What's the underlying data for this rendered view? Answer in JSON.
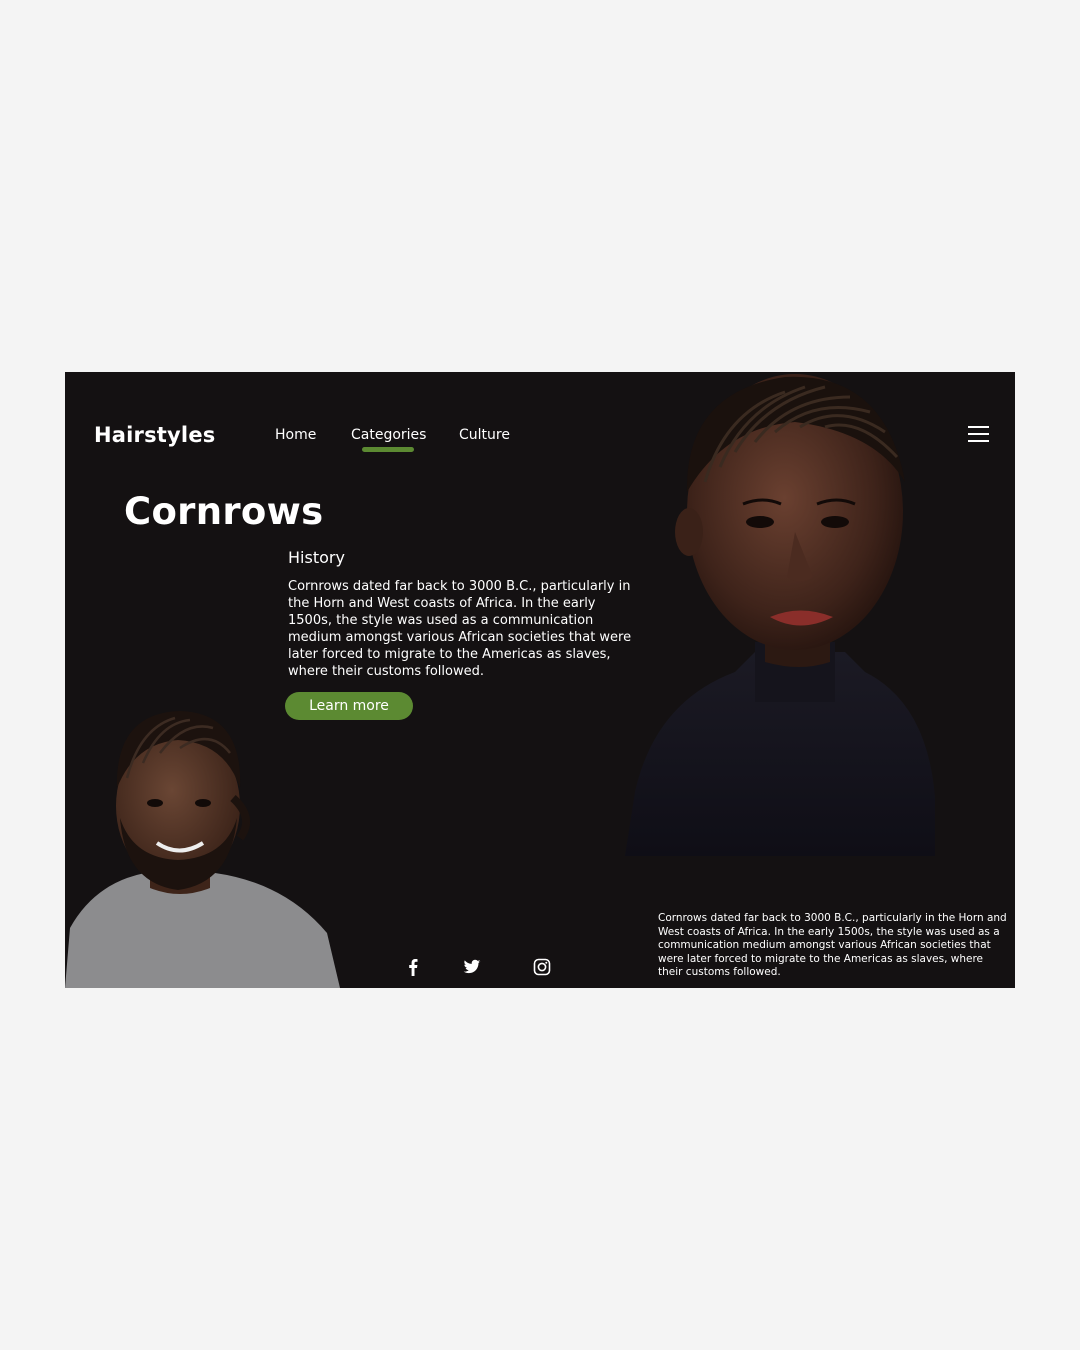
{
  "header": {
    "logo": "Hairstyles",
    "nav": [
      {
        "label": "Home"
      },
      {
        "label": "Categories",
        "active": true
      },
      {
        "label": "Culture"
      }
    ],
    "menu_icon": "hamburger-menu-icon"
  },
  "hero": {
    "title": "Cornrows",
    "section_heading": "History",
    "body": "Cornrows dated far back to 3000 B.C., particularly in the Horn and West coasts of Africa. In the early 1500s, the style was used as a communication medium amongst various African societies that were later forced to migrate to the Americas as slaves, where their customs followed.",
    "cta_label": "Learn more"
  },
  "social": [
    "facebook-icon",
    "twitter-icon",
    "instagram-icon"
  ],
  "footer": {
    "text": "Cornrows dated far back to 3000 B.C., particularly in the Horn and West coasts of Africa. In the early 1500s, the style was used as a communication medium amongst various African societies that were later forced to migrate to the Americas as slaves, where their customs followed."
  },
  "colors": {
    "background": "#f4f4f4",
    "panel": "#141112",
    "accent": "#5c8a32",
    "text": "#ffffff"
  }
}
